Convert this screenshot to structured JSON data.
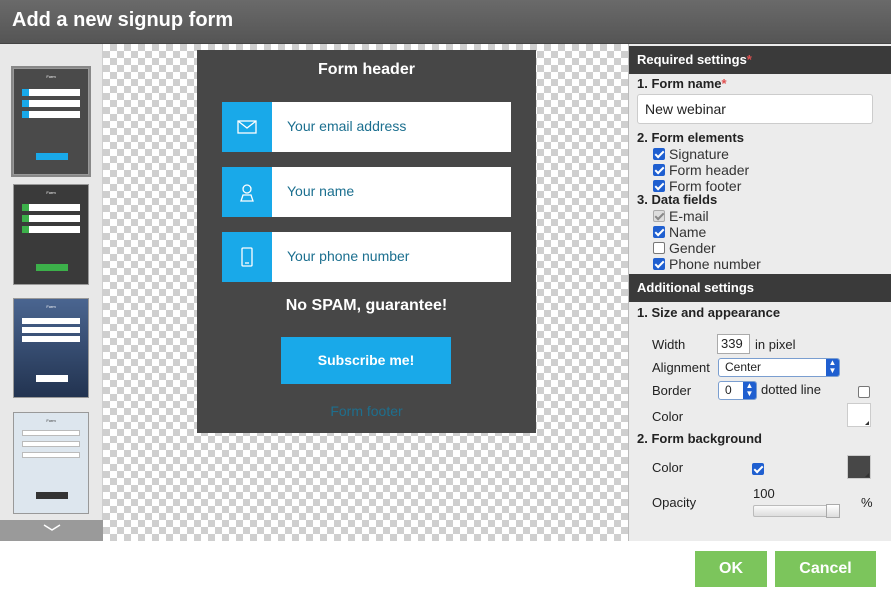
{
  "title": "Add a new signup form",
  "templates": {
    "scroll_icon": "chevron-down-icon"
  },
  "preview": {
    "header": "Form header",
    "fields": [
      {
        "icon": "envelope-icon",
        "label": "Your email address"
      },
      {
        "icon": "person-icon",
        "label": "Your name"
      },
      {
        "icon": "phone-icon",
        "label": "Your phone number"
      }
    ],
    "nospam": "No SPAM, guarantee!",
    "button": "Subscribe me!",
    "footer": "Form footer",
    "colors": {
      "background": "#474747",
      "accent": "#19a9e9"
    }
  },
  "settings": {
    "required_title": "Required settings",
    "required_star": "*",
    "form_name_label": "1. Form name",
    "form_name_value": "New webinar",
    "elements_label": "2. Form elements",
    "elements": [
      {
        "label": "Signature",
        "checked": true
      },
      {
        "label": "Form header",
        "checked": true
      },
      {
        "label": "Form footer",
        "checked": true
      }
    ],
    "data_fields_label": "3. Data fields",
    "data_fields": [
      {
        "label": "E-mail",
        "checked": true,
        "disabled": true
      },
      {
        "label": "Name",
        "checked": true
      },
      {
        "label": "Gender",
        "checked": false
      },
      {
        "label": "Phone number",
        "checked": true
      }
    ],
    "additional_title": "Additional settings",
    "size_label": "1. Size and appearance",
    "width_label": "Width",
    "width_value": "339",
    "width_unit": "in pixel",
    "alignment_label": "Alignment",
    "alignment_value": "Center",
    "border_label": "Border",
    "border_value": "0",
    "border_style": "dotted line",
    "border_dotted_checked": false,
    "color_label": "Color",
    "bg_label": "2. Form background",
    "bg_color_label": "Color",
    "bg_color_checked": true,
    "bg_color": "#474747",
    "opacity_label": "Opacity",
    "opacity_value": "100",
    "opacity_unit": "%"
  },
  "buttons": {
    "ok": "OK",
    "cancel": "Cancel"
  }
}
